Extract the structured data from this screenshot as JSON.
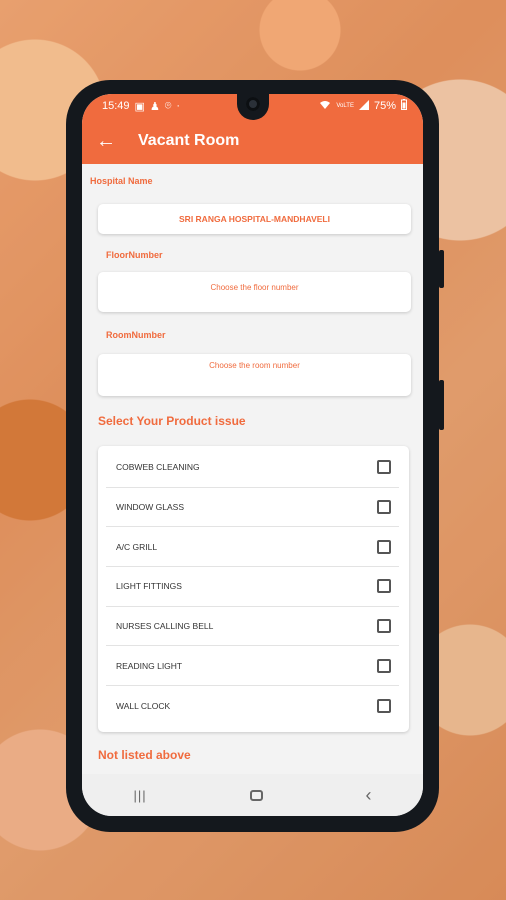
{
  "status_bar": {
    "time": "15:49",
    "left_icons": [
      "▣",
      "♟",
      "⌾",
      "·"
    ],
    "network": "VoLTE",
    "battery": "75%"
  },
  "app_bar": {
    "back_glyph": "←",
    "title": "Vacant Room"
  },
  "form": {
    "hospital_label": "Hospital Name",
    "hospital_value": "SRI RANGA HOSPITAL-MANDHAVELI",
    "floor_label": "FloorNumber",
    "floor_placeholder": "Choose the floor number",
    "room_label": "RoomNumber",
    "room_placeholder": "Choose the room number"
  },
  "issues": {
    "title": "Select Your Product issue",
    "items": [
      {
        "label": "COBWEB CLEANING",
        "checked": false
      },
      {
        "label": "WINDOW GLASS",
        "checked": false
      },
      {
        "label": "A/C GRILL",
        "checked": false
      },
      {
        "label": "LIGHT FITTINGS",
        "checked": false
      },
      {
        "label": "NURSES CALLING BELL",
        "checked": false
      },
      {
        "label": "READING LIGHT",
        "checked": false
      },
      {
        "label": "WALL CLOCK",
        "checked": false
      }
    ],
    "not_listed": "Not listed above"
  },
  "nav_bar": {
    "recents_glyph": "|||",
    "back_glyph": "‹"
  },
  "colors": {
    "accent": "#f06b3e",
    "phone_frame": "#14181d"
  }
}
